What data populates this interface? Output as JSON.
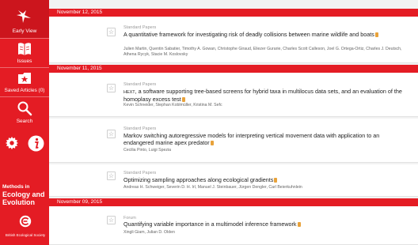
{
  "sidebar": {
    "items": [
      {
        "label": "Early View",
        "icon": "early-view-icon"
      },
      {
        "label": "Issues",
        "icon": "book-icon"
      },
      {
        "label": "Saved Articles (0)",
        "icon": "saved-star-icon"
      },
      {
        "label": "Search",
        "icon": "search-icon"
      }
    ],
    "journal_line1": "Methods in",
    "journal_line2": "Ecology and",
    "journal_line3": "Evolution",
    "society": "British Ecological Society"
  },
  "content": {
    "groups": [
      {
        "date": "November 12, 2015",
        "articles": [
          {
            "category": "Standard Papers",
            "title": "A quantitative framework for investigating risk of deadly collisions between marine wildlife and boats",
            "authors": "Julien Martin, Quentin Sabatier, Timothy A. Gowan, Christophe Giraud, Eliezer Gurarie, Charles Scott Calleson, Joel G. Ortega-Ortiz, Charles J. Deutsch, Athena Rycyk, Stacie M. Koslovsky"
          }
        ]
      },
      {
        "date": "November 11, 2015",
        "articles": [
          {
            "category": "Standard Papers",
            "title_prefix": "HEXT",
            "title": ", a software supporting tree-based screens for hybrid taxa in multilocus data sets, and an evaluation of the homoplasy excess test",
            "authors": "Kevin Schneider, Stephan Koblmüller, Kristina M. Sefc"
          },
          {
            "category": "Standard Papers",
            "title": "Markov switching autoregressive models for interpreting vertical movement data with application to an endangered marine apex predator",
            "authors": "Cecilia Pinto, Luigi Spezia"
          },
          {
            "category": "Standard Papers",
            "title": "Optimizing sampling approaches along ecological gradients",
            "authors": "Andreas H. Schweiger, Severin D. H. Irl, Manuel J. Steinbauer, Jürgen Dengler, Carl Beierkuhnlein"
          }
        ]
      },
      {
        "date": "November 09, 2015",
        "articles": [
          {
            "category": "Forum",
            "title": "Quantifying variable importance in a multimodel inference framework",
            "authors": "Xingli Giam, Julian D. Olden"
          }
        ]
      }
    ]
  },
  "colors": {
    "brand_red": "#e41c24",
    "active_red": "#cc151d",
    "open_access": "#e8a23a",
    "background": "#f2f2f2"
  }
}
